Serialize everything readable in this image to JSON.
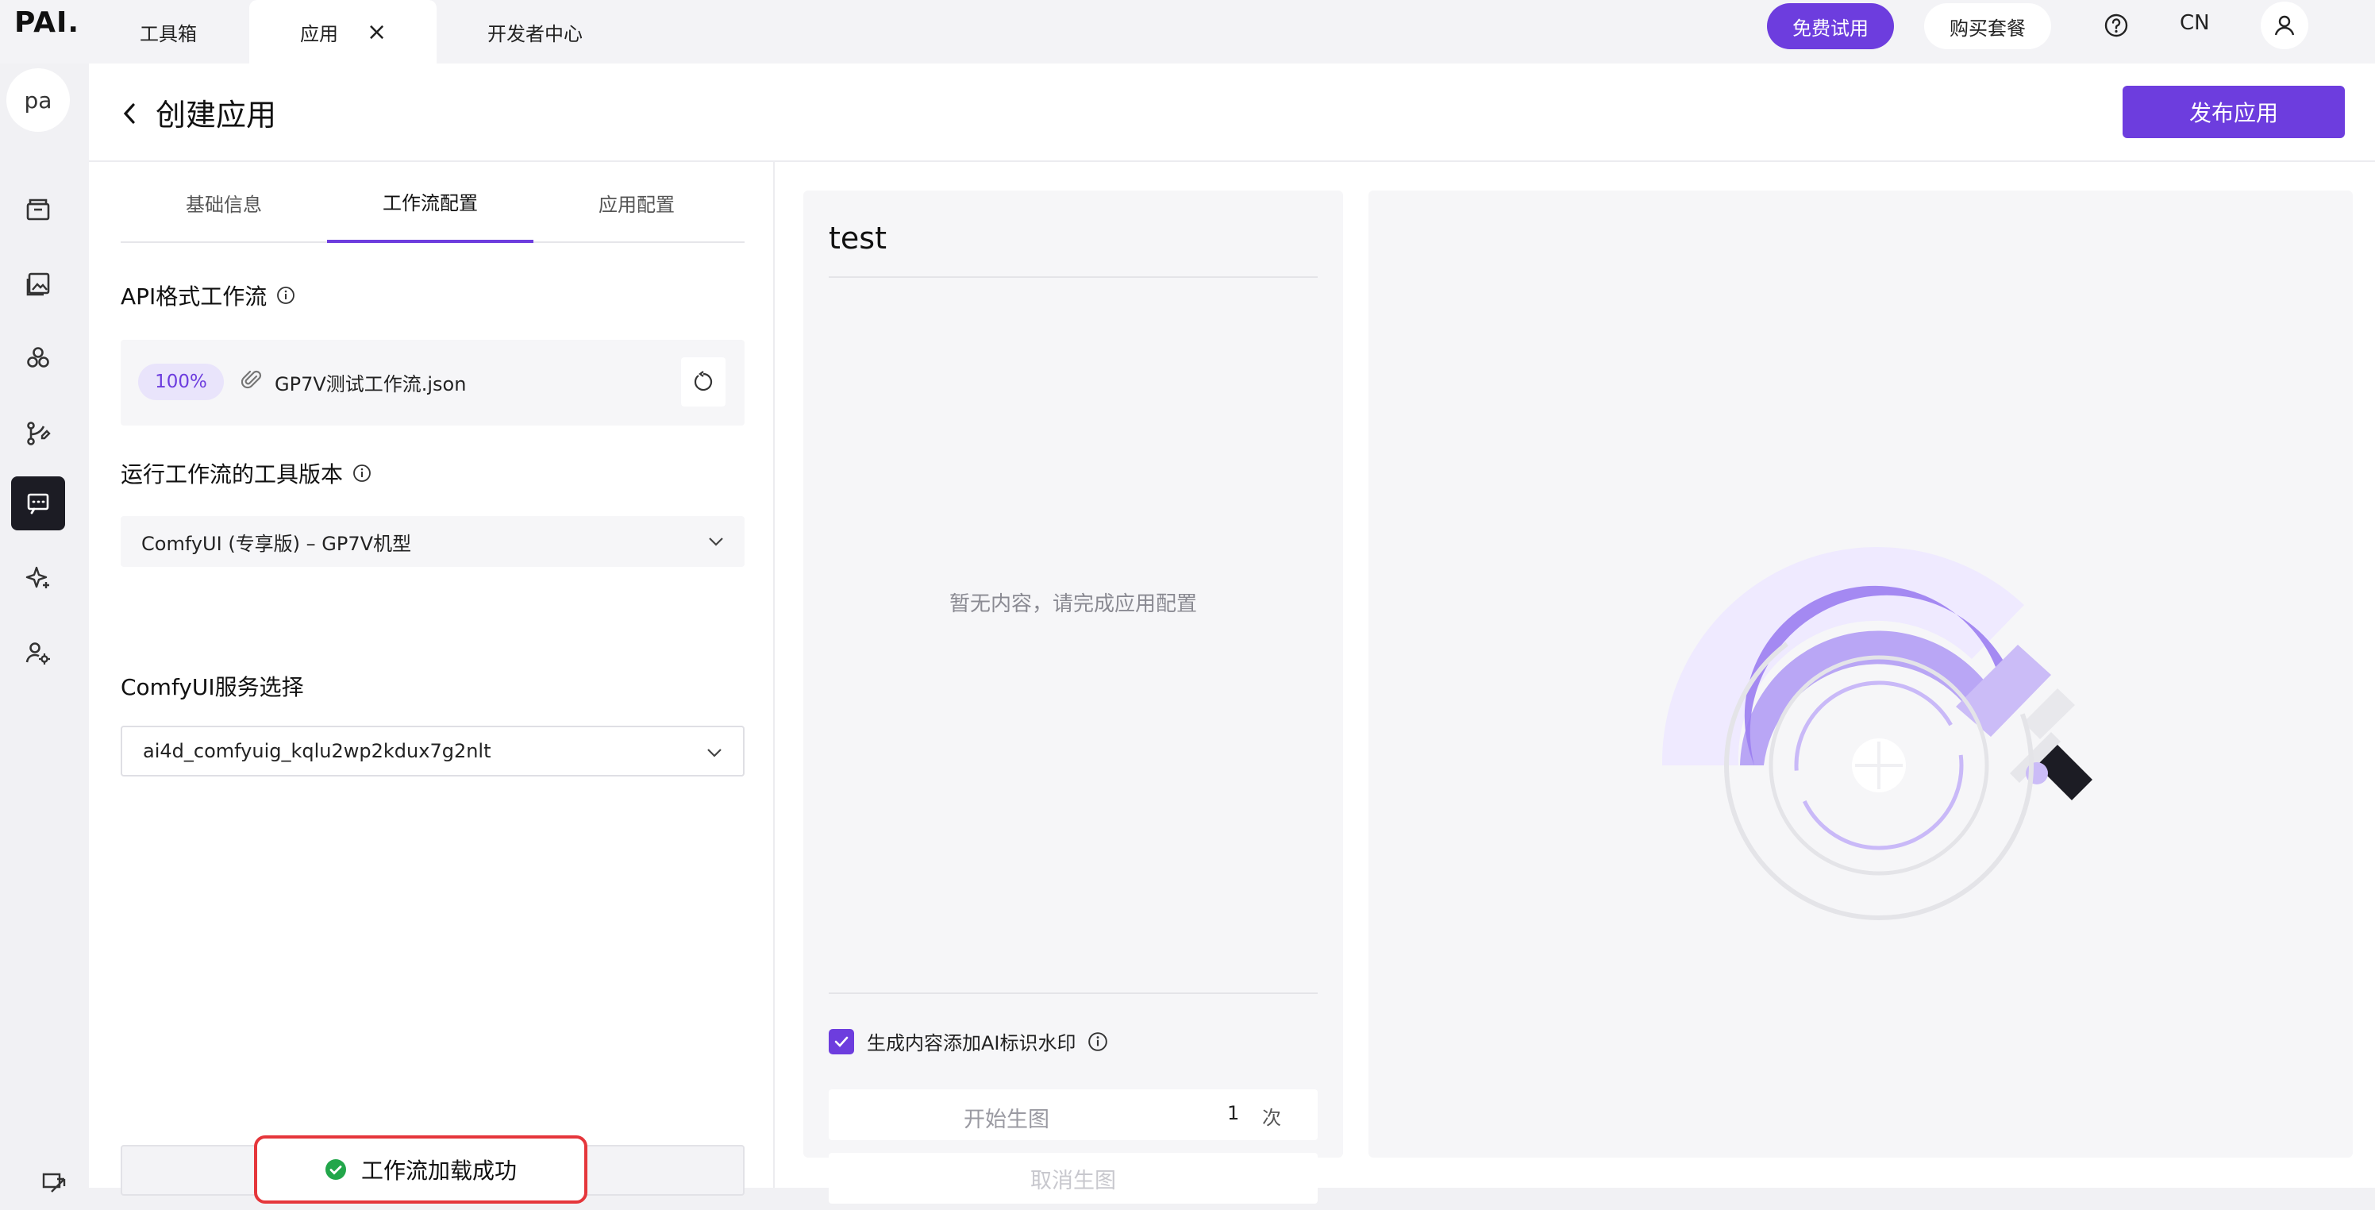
{
  "topbar": {
    "logo": "PAI.",
    "tabs": [
      {
        "label": "工具箱"
      },
      {
        "label": "应用"
      },
      {
        "label": "开发者中心"
      }
    ],
    "trial_label": "免费试用",
    "buy_label": "购买套餐",
    "lang": "CN"
  },
  "rail": {
    "avatar_text": "pa",
    "items": [
      "toolbox-icon",
      "gallery-icon",
      "models-icon",
      "workflow-icon",
      "app-icon",
      "sparkle-icon",
      "user-settings-icon"
    ]
  },
  "header": {
    "title": "创建应用",
    "publish_label": "发布应用"
  },
  "config": {
    "tabs": [
      {
        "label": "基础信息"
      },
      {
        "label": "工作流配置"
      },
      {
        "label": "应用配置"
      }
    ],
    "api_label": "API格式工作流",
    "upload_percent": "100%",
    "file_name": "GP7V测试工作流.json",
    "version_label": "运行工作流的工具版本",
    "version_value": "ComfyUI (专享版) – GP7V机型",
    "service_label": "ComfyUI服务选择",
    "service_value": "ai4d_comfyuig_kqlu2wp2kdux7g2nlt",
    "toast": "工作流加载成功"
  },
  "preview": {
    "title": "test",
    "empty_text": "暂无内容，请完成应用配置",
    "watermark_label": "生成内容添加AI标识水印",
    "watermark_checked": true,
    "start_label": "开始生图",
    "count": "1",
    "count_unit": "次",
    "cancel_label": "取消生图"
  },
  "colors": {
    "accent": "#6d3dde",
    "toast_border": "#e5363b",
    "success": "#22a64a"
  }
}
